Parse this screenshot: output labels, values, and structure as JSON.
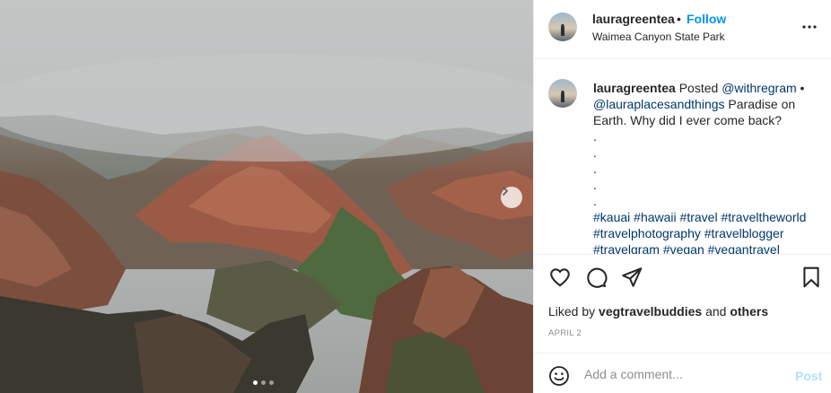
{
  "post": {
    "username": "lauragreentea",
    "separator": "•",
    "follow_label": "Follow",
    "location": "Waimea Canyon State Park",
    "caption": {
      "username": "lauragreentea",
      "text_posted": " Posted ",
      "mention1": "@withregram",
      "bullet": " •",
      "mention2": "@lauraplacesandthings",
      "text_body": " Paradise on Earth. Why did I ever come back?",
      "dots": [
        ".",
        ".",
        ".",
        ".",
        "."
      ],
      "hashtags_line1": [
        "#kauai",
        "#hawaii",
        "#travel",
        "#traveltheworld"
      ],
      "hashtags_line2": [
        "#travelphotography",
        "#travelblogger"
      ],
      "hashtags_line3": [
        "#travelgram",
        "#vegan",
        "#vegantravel"
      ]
    },
    "liked_by_prefix": "Liked by ",
    "liked_by_user": "vegtravelbuddies",
    "liked_by_and": " and ",
    "liked_by_others": "others",
    "date": "APRIL 2",
    "comment_placeholder": "Add a comment...",
    "post_button": "Post"
  },
  "carousel": {
    "slide_count": 3,
    "active_index": 0
  },
  "icons": {
    "next": "chevron-right-icon",
    "more": "more-horizontal-icon",
    "like": "heart-icon",
    "comment": "comment-icon",
    "share": "share-icon",
    "save": "bookmark-icon",
    "emoji": "emoji-icon"
  },
  "colors": {
    "link_blue": "#0095f6",
    "hashtag_blue": "#00376b",
    "muted": "#8e8e8e",
    "post_disabled": "#b2dffc"
  }
}
